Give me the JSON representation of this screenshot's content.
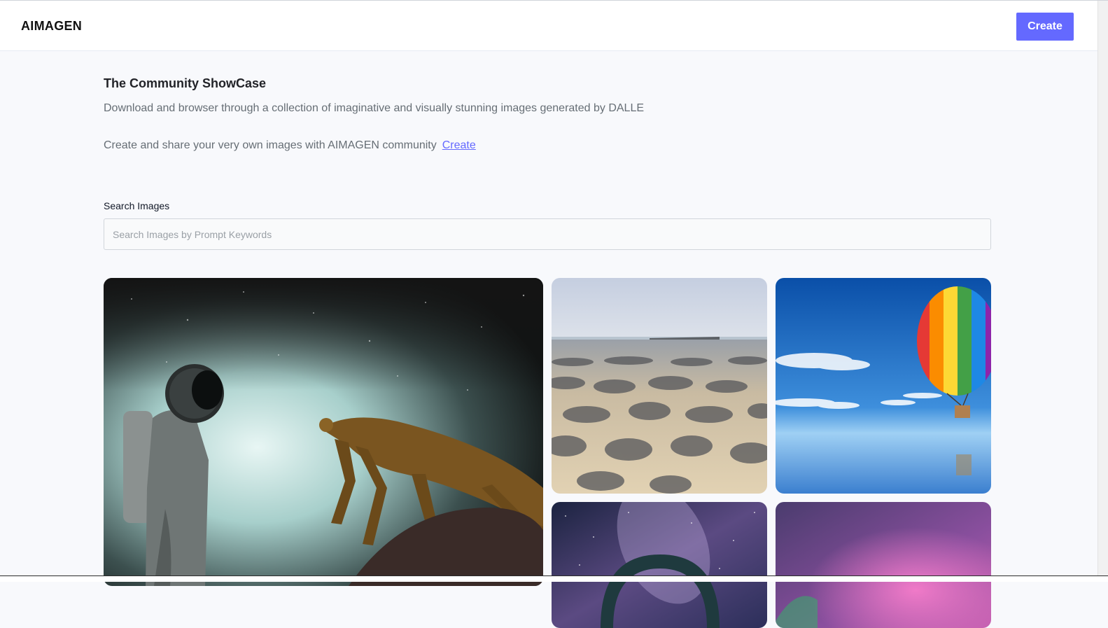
{
  "header": {
    "logo": "AIMAGEN",
    "create_label": "Create"
  },
  "hero": {
    "title": "The Community ShowCase",
    "description": "Download and browser through a collection of imaginative and visually stunning images generated by DALLE",
    "share_text": "Create and share your very own images with AIMAGEN community",
    "share_link": "Create"
  },
  "search": {
    "label": "Search Images",
    "placeholder": "Search Images by Prompt Keywords",
    "value": ""
  },
  "gallery": {
    "items": [
      {
        "subject": "astronaut and praying mantis"
      },
      {
        "subject": "rippled sand beach"
      },
      {
        "subject": "rainbow hot air balloon over sea"
      },
      {
        "subject": "milky way night sky"
      },
      {
        "subject": "aurora purple sky"
      }
    ]
  },
  "colors": {
    "accent": "#6469ff",
    "background": "#f8f9fc",
    "text_muted": "#666e75"
  }
}
